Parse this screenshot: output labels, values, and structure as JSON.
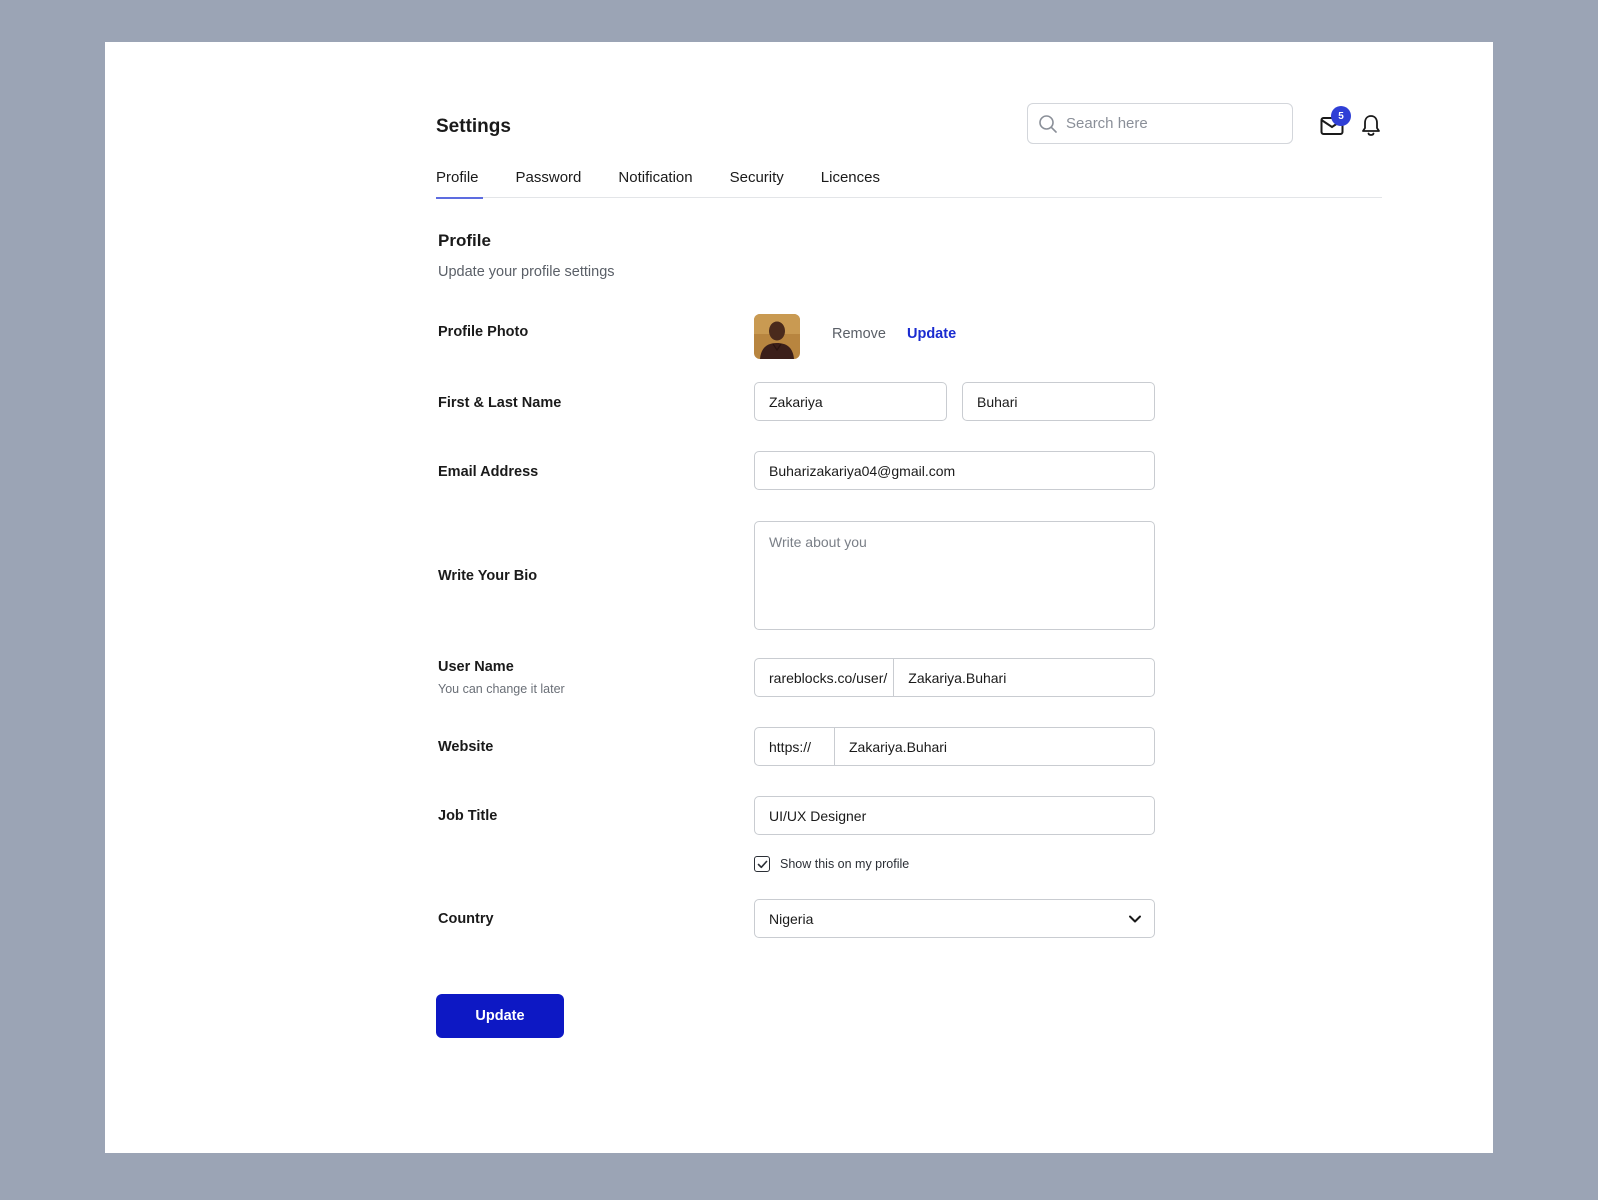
{
  "header": {
    "title": "Settings",
    "search_placeholder": "Search here",
    "mail_badge": "5"
  },
  "tabs": [
    {
      "label": "Profile",
      "active": true
    },
    {
      "label": "Password",
      "active": false
    },
    {
      "label": "Notification",
      "active": false
    },
    {
      "label": "Security",
      "active": false
    },
    {
      "label": "Licences",
      "active": false
    }
  ],
  "section": {
    "title": "Profile",
    "subtitle": "Update your profile settings"
  },
  "form": {
    "photo": {
      "label": "Profile Photo",
      "remove": "Remove",
      "update": "Update"
    },
    "name": {
      "label": "First & Last Name",
      "first": "Zakariya",
      "last": "Buhari"
    },
    "email": {
      "label": "Email Address",
      "value": "Buharizakariya04@gmail.com"
    },
    "bio": {
      "label": "Write Your Bio",
      "placeholder": "Write about you",
      "value": ""
    },
    "username": {
      "label": "User Name",
      "hint": "You can change it later",
      "prefix": "rareblocks.co/user/",
      "value": "Zakariya.Buhari"
    },
    "website": {
      "label": "Website",
      "prefix": "https://",
      "value": "Zakariya.Buhari"
    },
    "job": {
      "label": "Job Title",
      "value": "UI/UX Designer",
      "show_on_profile": "Show this on my profile",
      "checked": true
    },
    "country": {
      "label": "Country",
      "value": "Nigeria"
    }
  },
  "submit_label": "Update",
  "colors": {
    "accent": "#0d18c4",
    "badge": "#2f3fd6",
    "tab_underline": "#5d6ce0",
    "background": "#9ba4b5"
  }
}
